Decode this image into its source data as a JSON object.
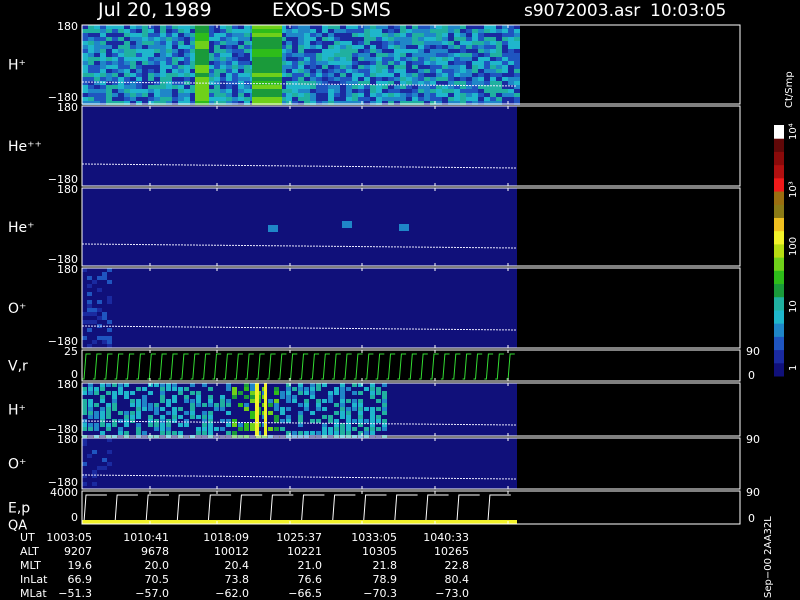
{
  "header": {
    "date": "Jul 20, 1989",
    "instrument": "EXOS-D SMS",
    "filename": "s9072003.asr",
    "time": "10:03:05"
  },
  "colorbar": {
    "unit_label": "Ct/Smp",
    "ticks": [
      "1",
      "10",
      "100",
      "10³",
      "10⁴"
    ],
    "colors": [
      "#10107a",
      "#1a2aa0",
      "#1f55c0",
      "#1f86c8",
      "#1fb6cc",
      "#20b0a0",
      "#1a9a3a",
      "#2ebc1a",
      "#6fd01a",
      "#b6dc12",
      "#f2f22a",
      "#f0c020",
      "#8a7a16",
      "#9a6e10",
      "#f01a1a",
      "#b01010",
      "#8a0a0a",
      "#600808",
      "#ffffff"
    ]
  },
  "panels": [
    {
      "label": "H⁺",
      "top": "180",
      "bottom": "−180"
    },
    {
      "label": "He⁺⁺",
      "top": "180",
      "bottom": "−180"
    },
    {
      "label": "He⁺",
      "top": "180",
      "bottom": "−180"
    },
    {
      "label": "O⁺",
      "top": "180",
      "bottom": "−180"
    },
    {
      "label": "V,r",
      "top": "25",
      "bottom": "0",
      "right_top": "90",
      "right_bottom": "0"
    },
    {
      "label": "H⁺",
      "top": "180",
      "bottom": "−180"
    },
    {
      "label": "O⁺",
      "top": "180",
      "bottom": "−180",
      "right_top": "90"
    },
    {
      "label": "E,p",
      "label2": "QA",
      "top": "4000",
      "bottom": "0",
      "right_top": "90",
      "right_bottom": "0"
    }
  ],
  "orbit": {
    "row_labels": [
      "UT",
      "ALT",
      "MLT",
      "InLat",
      "MLat"
    ],
    "columns": [
      {
        "UT": "1003:05",
        "ALT": "9207",
        "MLT": "19.6",
        "InLat": "66.9",
        "MLat": "−51.3"
      },
      {
        "UT": "1010:41",
        "ALT": "9678",
        "MLT": "20.0",
        "InLat": "70.5",
        "MLat": "−57.0"
      },
      {
        "UT": "1018:09",
        "ALT": "10012",
        "MLT": "20.4",
        "InLat": "73.8",
        "MLat": "−62.0"
      },
      {
        "UT": "1025:37",
        "ALT": "10221",
        "MLT": "21.0",
        "InLat": "76.6",
        "MLat": "−66.5"
      },
      {
        "UT": "1033:05",
        "ALT": "10305",
        "MLT": "21.8",
        "InLat": "78.9",
        "MLat": "−70.3"
      },
      {
        "UT": "1040:33",
        "ALT": "10265",
        "MLT": "22.8",
        "InLat": "80.4",
        "MLat": "−73.0"
      }
    ]
  },
  "side_label": "Sep−00  2AA32L",
  "chart_data": {
    "type": "heatmap",
    "x": [
      "1003:05",
      "1010:41",
      "1018:09",
      "1025:37",
      "1033:05",
      "1040:33"
    ],
    "y_range": [
      -180,
      180
    ],
    "color_scale": "log",
    "color_range": [
      1,
      10000
    ]
  }
}
